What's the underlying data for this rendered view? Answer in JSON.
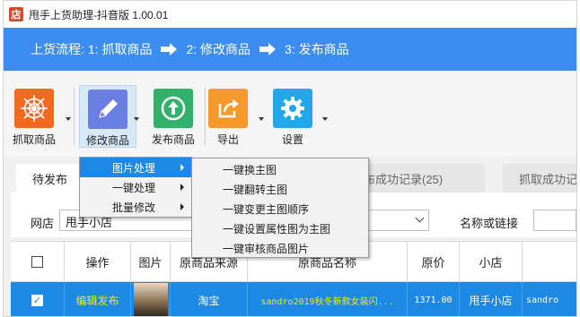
{
  "window": {
    "title": "甩手上货助理-抖音版 1.00.01",
    "app_icon_text": "店"
  },
  "flow": {
    "label": "上货流程:",
    "steps": [
      "1: 抓取商品",
      "2: 修改商品",
      "3: 发布商品"
    ]
  },
  "toolbar": {
    "items": [
      {
        "label": "抓取商品",
        "icon": "spider-web-icon"
      },
      {
        "label": "修改商品",
        "icon": "pencil-icon"
      },
      {
        "label": "发布商品",
        "icon": "upload-circle-icon"
      },
      {
        "label": "导出",
        "icon": "export-share-icon"
      },
      {
        "label": "设置",
        "icon": "gear-icon"
      }
    ]
  },
  "tabs": [
    "待发布",
    "发布成功记录(25)",
    "抓取成功记"
  ],
  "filter": {
    "shop_label": "网店",
    "shop_value": "甩手小店",
    "keyword_label": "名称或链接"
  },
  "table": {
    "headers": [
      "",
      "操作",
      "图片",
      "原商品来源",
      "原商品名称",
      "原价",
      "小店",
      ""
    ],
    "rows": [
      {
        "checked": true,
        "action": "编辑发布",
        "source": "淘宝",
        "name": "sandro2019秋冬新款女装闪...",
        "price": "1371.00",
        "shop": "甩手小店",
        "extra": "sandro"
      }
    ]
  },
  "menu": {
    "items": [
      "图片处理",
      "一键处理",
      "批量修改"
    ],
    "submenu": [
      "一键换主图",
      "一键翻转主图",
      "一键变更主图顺序",
      "一键设置属性图为主图",
      "一键审核商品图片"
    ]
  },
  "colors": {
    "accent": "#3d8df0",
    "selection": "#1e88e5",
    "link_yellow": "#ffe600"
  }
}
